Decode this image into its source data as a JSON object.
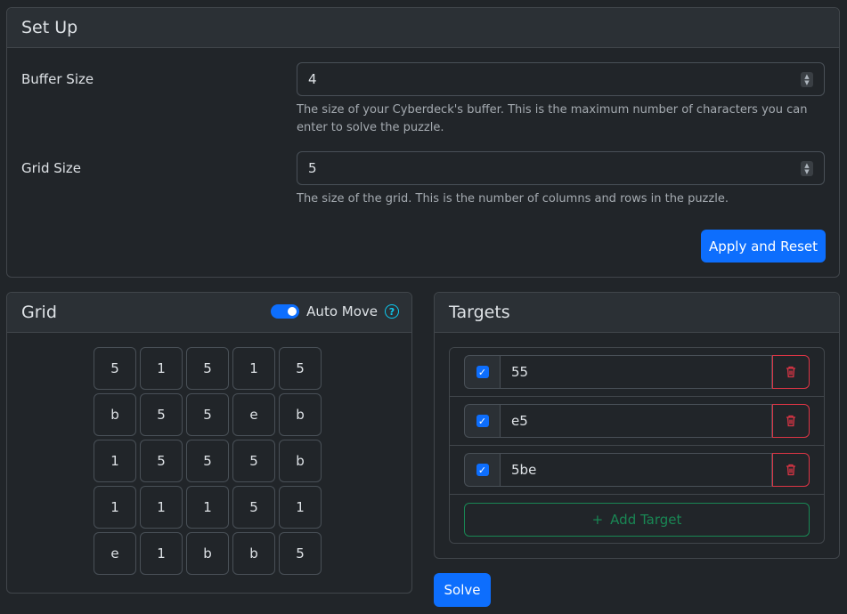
{
  "setup": {
    "title": "Set Up",
    "buffer_label": "Buffer Size",
    "buffer_value": "4",
    "buffer_help": "The size of your Cyberdeck's buffer. This is the maximum number of characters you can enter to solve the puzzle.",
    "grid_label": "Grid Size",
    "grid_value": "5",
    "grid_help": "The size of the grid. This is the number of columns and rows in the puzzle.",
    "apply_label": "Apply and Reset"
  },
  "grid": {
    "title": "Grid",
    "auto_move_label": "Auto Move",
    "auto_move_on": true,
    "help_icon": "question-circle-icon",
    "cells": [
      [
        "5",
        "1",
        "5",
        "1",
        "5"
      ],
      [
        "b",
        "5",
        "5",
        "e",
        "b"
      ],
      [
        "1",
        "5",
        "5",
        "5",
        "b"
      ],
      [
        "1",
        "1",
        "1",
        "5",
        "1"
      ],
      [
        "e",
        "1",
        "b",
        "b",
        "5"
      ]
    ]
  },
  "targets": {
    "title": "Targets",
    "items": [
      {
        "checked": true,
        "value": "55"
      },
      {
        "checked": true,
        "value": "e5"
      },
      {
        "checked": true,
        "value": "5be"
      }
    ],
    "add_label": "Add Target",
    "add_icon": "plus-icon",
    "delete_icon": "trash-icon"
  },
  "solve_label": "Solve",
  "colors": {
    "background": "#212529",
    "primary": "#0d6efd",
    "danger": "#dc3545",
    "success": "#198754",
    "info": "#0dcaf0"
  }
}
